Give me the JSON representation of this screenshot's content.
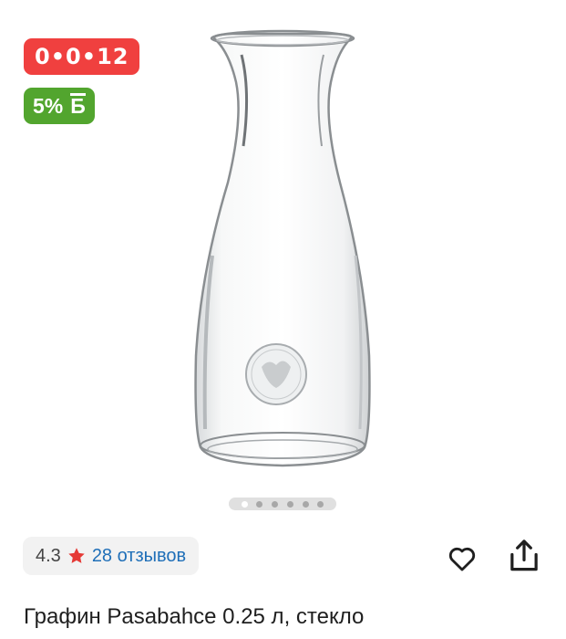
{
  "badges": {
    "installment": {
      "text": "0•0•12",
      "color": "#f0403f"
    },
    "cashback": {
      "percent": "5%",
      "symbol": "Б",
      "color": "#52a52e"
    }
  },
  "gallery": {
    "image_icon": "glass-carafe",
    "slides_total": 6,
    "active_slide": 1
  },
  "rating": {
    "value": "4.3",
    "star_icon": "star-icon",
    "star_color": "#e53935",
    "reviews_label": "28 отзывов",
    "link_color": "#1f6fb8"
  },
  "actions": {
    "favorite_icon": "heart-icon",
    "share_icon": "share-icon"
  },
  "product": {
    "title": "Графин Pasabahce 0.25 л, стекло"
  }
}
